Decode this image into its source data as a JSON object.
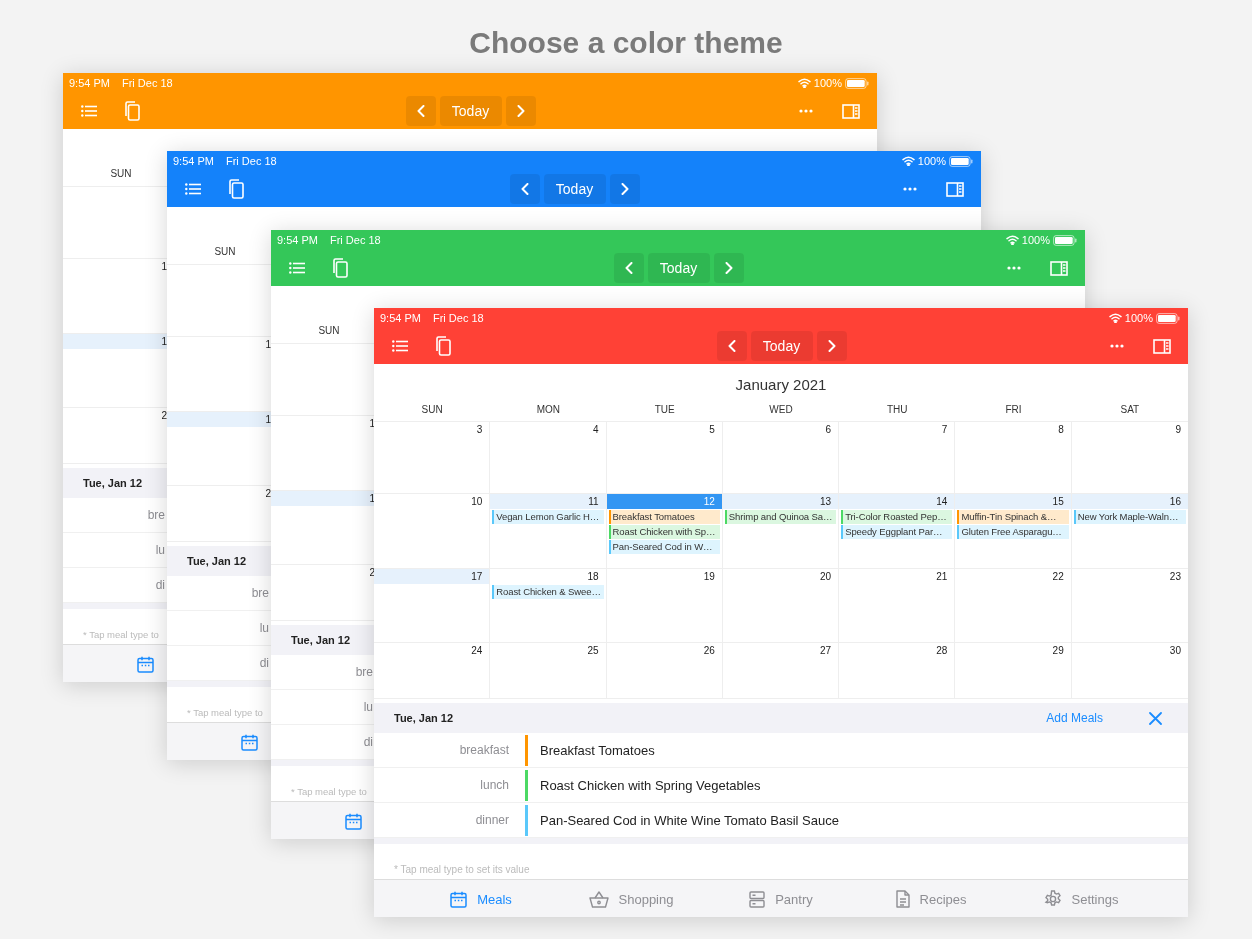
{
  "headline": "Choose a color theme",
  "windows": [
    {
      "kind": "preview",
      "color": "#ff9500",
      "status": {
        "time": "9:54 PM",
        "date": "Fri Dec 18",
        "battery": "100%"
      },
      "toolbar": {
        "today": "Today"
      },
      "weekday": "SUN",
      "weeks": [
        {
          "day": "1",
          "highlighted": false
        },
        {
          "day": "1",
          "highlighted": true
        },
        {
          "day": "2",
          "highlighted": false
        }
      ],
      "panel": {
        "date": "Tue, Jan 12",
        "meals": [
          {
            "type": "bre"
          },
          {
            "type": "lu"
          },
          {
            "type": "di"
          }
        ],
        "note": "* Tap meal type to"
      },
      "tab": {
        "selected": true
      }
    },
    {
      "kind": "preview",
      "color": "#1482fa",
      "status": {
        "time": "9:54 PM",
        "date": "Fri Dec 18",
        "battery": "100%"
      },
      "toolbar": {
        "today": "Today"
      },
      "weekday": "SUN",
      "weeks": [
        {
          "day": "1",
          "highlighted": false
        },
        {
          "day": "1",
          "highlighted": true
        },
        {
          "day": "2",
          "highlighted": false
        }
      ],
      "panel": {
        "date": "Tue, Jan 12",
        "meals": [
          {
            "type": "bre"
          },
          {
            "type": "lu"
          },
          {
            "type": "di"
          }
        ],
        "note": "* Tap meal type to"
      },
      "tab": {
        "selected": true
      }
    },
    {
      "kind": "preview",
      "color": "#34c759",
      "status": {
        "time": "9:54 PM",
        "date": "Fri Dec 18",
        "battery": "100%"
      },
      "toolbar": {
        "today": "Today"
      },
      "weekday": "SUN",
      "weeks": [
        {
          "day": "1",
          "highlighted": false
        },
        {
          "day": "1",
          "highlighted": true
        },
        {
          "day": "2",
          "highlighted": false
        }
      ],
      "panel": {
        "date": "Tue, Jan 12",
        "meals": [
          {
            "type": "bre"
          },
          {
            "type": "lu"
          },
          {
            "type": "di"
          }
        ],
        "note": "* Tap meal type to"
      },
      "tab": {
        "selected": true
      }
    },
    {
      "kind": "full",
      "color": "#ff4136",
      "status": {
        "time": "9:54 PM",
        "date": "Fri Dec 18",
        "battery": "100%"
      },
      "toolbar": {
        "today": "Today"
      },
      "month": "January 2021",
      "weekdays": [
        "SUN",
        "MON",
        "TUE",
        "WED",
        "THU",
        "FRI",
        "SAT"
      ],
      "cells": [
        {
          "day": "3",
          "highlighted": false,
          "selected": false
        },
        {
          "day": "4",
          "highlighted": false,
          "selected": false
        },
        {
          "day": "5",
          "highlighted": false,
          "selected": false
        },
        {
          "day": "6",
          "highlighted": false,
          "selected": false
        },
        {
          "day": "7",
          "highlighted": false,
          "selected": false
        },
        {
          "day": "8",
          "highlighted": false,
          "selected": false
        },
        {
          "day": "9",
          "highlighted": false,
          "selected": false
        },
        {
          "day": "10",
          "highlighted": false,
          "selected": false
        },
        {
          "day": "11",
          "highlighted": true,
          "selected": false,
          "meals": [
            {
              "name": "Vegan Lemon Garlic H…",
              "color": "#5ac8fa"
            }
          ]
        },
        {
          "day": "12",
          "highlighted": true,
          "selected": true,
          "meals": [
            {
              "name": "Breakfast Tomatoes",
              "color": "#ff9500"
            },
            {
              "name": "Roast Chicken with Sp…",
              "color": "#4cd964"
            },
            {
              "name": "Pan-Seared Cod in W…",
              "color": "#5ac8fa"
            }
          ]
        },
        {
          "day": "13",
          "highlighted": true,
          "selected": false,
          "meals": [
            {
              "name": "Shrimp and Quinoa Sa…",
              "color": "#4cd964"
            }
          ]
        },
        {
          "day": "14",
          "highlighted": true,
          "selected": false,
          "meals": [
            {
              "name": "Tri-Color Roasted Pep…",
              "color": "#4cd964"
            },
            {
              "name": "Speedy Eggplant Par…",
              "color": "#5ac8fa"
            }
          ]
        },
        {
          "day": "15",
          "highlighted": true,
          "selected": false,
          "meals": [
            {
              "name": "Muffin-Tin Spinach &…",
              "color": "#ff9500"
            },
            {
              "name": "Gluten Free Asparagu…",
              "color": "#5ac8fa"
            }
          ]
        },
        {
          "day": "16",
          "highlighted": true,
          "selected": false,
          "meals": [
            {
              "name": "New York Maple-Waln…",
              "color": "#5ac8fa"
            }
          ]
        },
        {
          "day": "17",
          "highlighted": true,
          "selected": false
        },
        {
          "day": "18",
          "highlighted": false,
          "selected": false,
          "meals": [
            {
              "name": "Roast Chicken & Swee…",
              "color": "#5ac8fa"
            }
          ]
        },
        {
          "day": "19",
          "highlighted": false,
          "selected": false
        },
        {
          "day": "20",
          "highlighted": false,
          "selected": false
        },
        {
          "day": "21",
          "highlighted": false,
          "selected": false
        },
        {
          "day": "22",
          "highlighted": false,
          "selected": false
        },
        {
          "day": "23",
          "highlighted": false,
          "selected": false
        },
        {
          "day": "24",
          "highlighted": false,
          "selected": false
        },
        {
          "day": "25",
          "highlighted": false,
          "selected": false
        },
        {
          "day": "26",
          "highlighted": false,
          "selected": false
        },
        {
          "day": "27",
          "highlighted": false,
          "selected": false
        },
        {
          "day": "28",
          "highlighted": false,
          "selected": false
        },
        {
          "day": "29",
          "highlighted": false,
          "selected": false
        },
        {
          "day": "30",
          "highlighted": false,
          "selected": false
        }
      ],
      "panel": {
        "date": "Tue, Jan 12",
        "action": "Add Meals",
        "meals": [
          {
            "type": "breakfast",
            "name": "Breakfast Tomatoes",
            "color": "#ff9500"
          },
          {
            "type": "lunch",
            "name": "Roast Chicken with Spring Vegetables",
            "color": "#4cd964"
          },
          {
            "type": "dinner",
            "name": "Pan-Seared Cod in White Wine Tomato Basil Sauce",
            "color": "#5ac8fa"
          }
        ],
        "note": "* Tap meal type to set its value"
      },
      "tabs": [
        {
          "label": "Meals",
          "selected": true
        },
        {
          "label": "Shopping",
          "selected": false
        },
        {
          "label": "Pantry",
          "selected": false
        },
        {
          "label": "Recipes",
          "selected": false
        },
        {
          "label": "Settings",
          "selected": false
        }
      ]
    }
  ]
}
